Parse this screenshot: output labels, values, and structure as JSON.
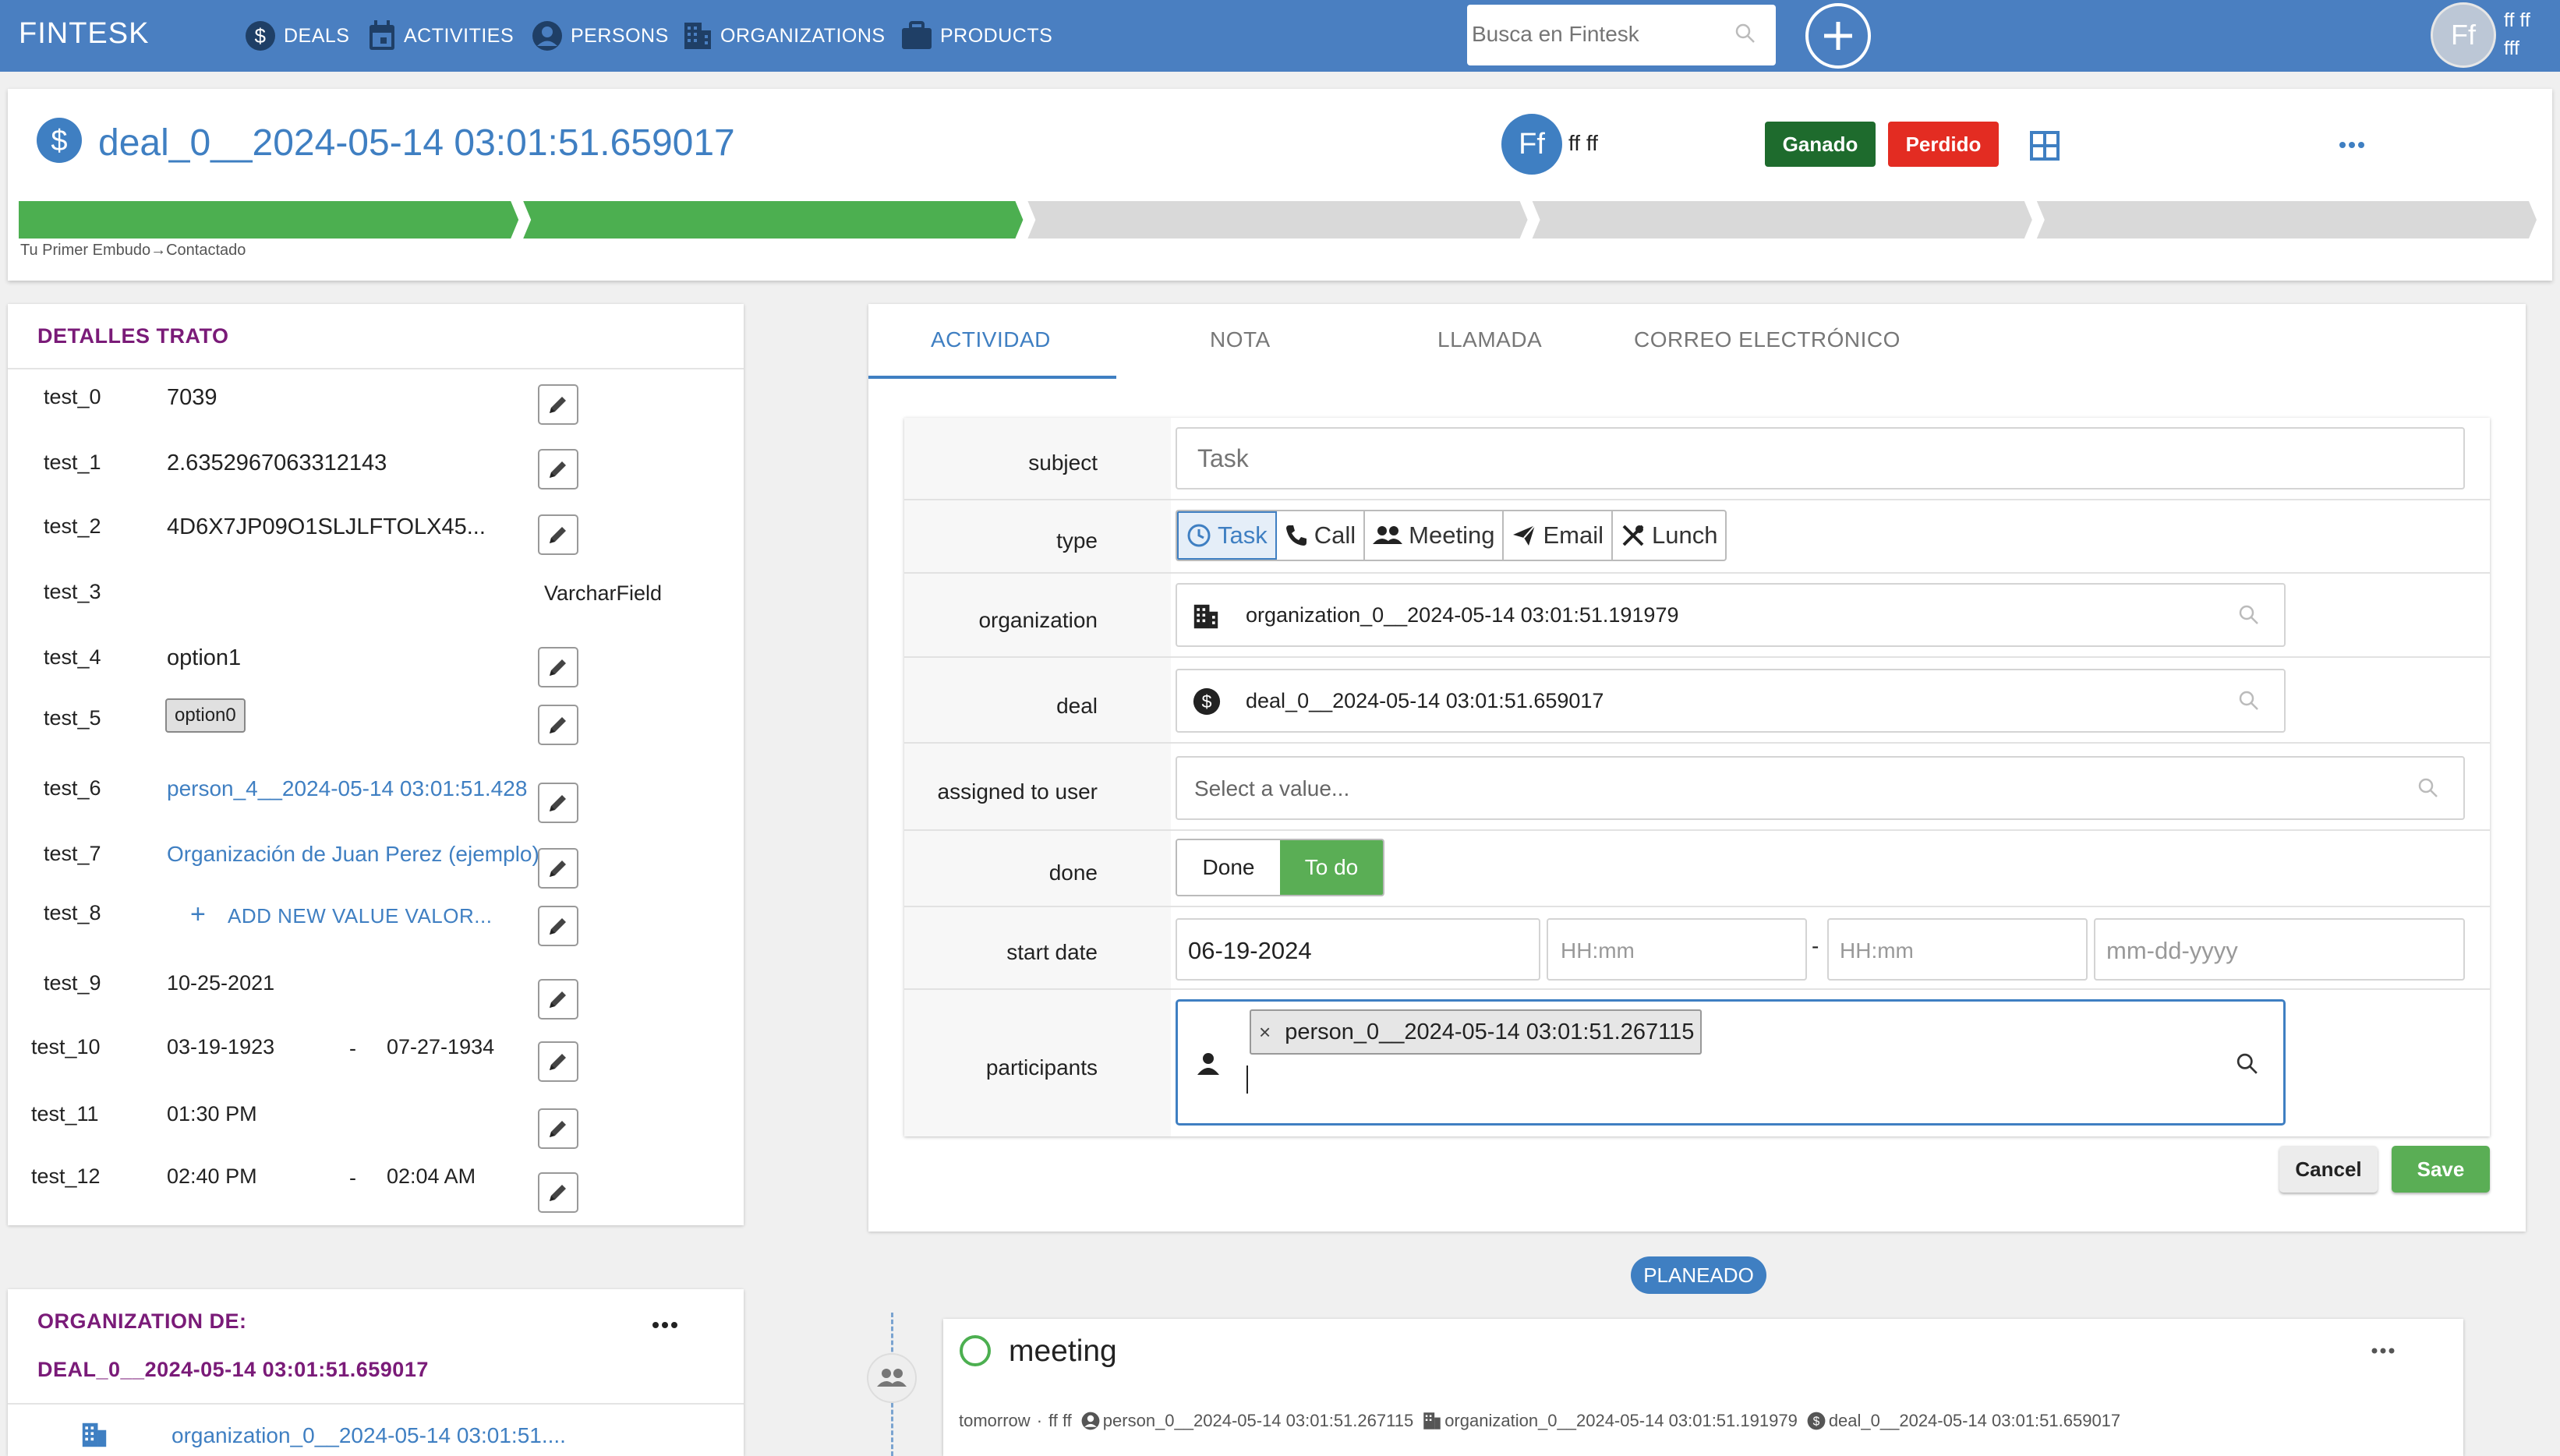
{
  "nav": {
    "brand": "FINTESK",
    "items": [
      {
        "label": "DEALS",
        "icon": "dollar-icon"
      },
      {
        "label": "ACTIVITIES",
        "icon": "calendar-icon"
      },
      {
        "label": "PERSONS",
        "icon": "person-icon"
      },
      {
        "label": "ORGANIZATIONS",
        "icon": "building-icon"
      },
      {
        "label": "PRODUCTS",
        "icon": "briefcase-icon"
      }
    ],
    "search_placeholder": "Busca en Fintesk",
    "user_initials": "Ff",
    "user_name_line1": "ff ff",
    "user_name_line2": "fff"
  },
  "header": {
    "deal_title": "deal_0__2024-05-14 03:01:51.659017",
    "owner_initials": "Ff",
    "owner_name": "ff ff",
    "won_label": "Ganado",
    "lost_label": "Perdido",
    "breadcrumb_pipeline": "Tu Primer Embudo",
    "breadcrumb_stage": "Contactado",
    "pipeline_stages_completed": 2,
    "pipeline_stages_total": 5,
    "colors": {
      "accent": "#3f7fc2",
      "nav": "#4a7fc1",
      "stage_done": "#4caf50",
      "stage_todo": "#d9d9d9"
    }
  },
  "details": {
    "title": "DETALLES TRATO",
    "fields": [
      {
        "label": "test_0",
        "value": "7039"
      },
      {
        "label": "test_1",
        "value": "2.6352967063312143"
      },
      {
        "label": "test_2",
        "value": "4D6X7JP09O1SLJLFTOLX45..."
      },
      {
        "label": "test_3",
        "value": "VarcharField"
      },
      {
        "label": "test_4",
        "value": "option1"
      },
      {
        "label": "test_5",
        "value": "option0"
      },
      {
        "label": "test_6",
        "value": "person_4__2024-05-14 03:01:51.428"
      },
      {
        "label": "test_7",
        "value": "Organización de Juan Perez (ejemplo)"
      },
      {
        "label": "test_8",
        "value": "ADD NEW VALUE VALOR..."
      },
      {
        "label": "test_9",
        "value": "10-25-2021"
      },
      {
        "label": "test_10",
        "value": "03-19-1923",
        "value2": "07-27-1934"
      },
      {
        "label": "test_11",
        "value": "01:30 PM"
      },
      {
        "label": "test_12",
        "value": "02:40 PM",
        "value2": "02:04 AM"
      }
    ],
    "range_separator": "-"
  },
  "org_section": {
    "title_line1": "ORGANIZATION DE:",
    "title_line2": "DEAL_0__2024-05-14 03:01:51.659017",
    "org_name": "organization_0__2024-05-14 03:01:51...."
  },
  "tabs": [
    "ACTIVIDAD",
    "NOTA",
    "LLAMADA",
    "CORREO ELECTRÓNICO"
  ],
  "form": {
    "subject_label": "subject",
    "subject_placeholder": "Task",
    "type_label": "type",
    "types": [
      "Task",
      "Call",
      "Meeting",
      "Email",
      "Lunch"
    ],
    "organization_label": "organization",
    "organization_value": "organization_0__2024-05-14 03:01:51.191979",
    "deal_label": "deal",
    "deal_value": "deal_0__2024-05-14 03:01:51.659017",
    "assigned_label": "assigned to user",
    "assigned_placeholder": "Select a value...",
    "done_label": "done",
    "done_option": "Done",
    "todo_option": "To do",
    "start_date_label": "start date",
    "start_date": "06-19-2024",
    "time_placeholder": "HH:mm",
    "end_date_placeholder": "mm-dd-yyyy",
    "participants_label": "participants",
    "participant_chip": "person_0__2024-05-14 03:01:51.267115",
    "chip_remove": "×",
    "cancel_label": "Cancel",
    "save_label": "Save"
  },
  "timeline": {
    "planned_label": "PLANEADO",
    "activity_title": "meeting",
    "when": "tomorrow",
    "sep": "·",
    "owner": "ff ff",
    "person": "person_0__2024-05-14 03:01:51.267115",
    "organization": "organization_0__2024-05-14 03:01:51.191979",
    "deal": "deal_0__2024-05-14 03:01:51.659017"
  }
}
